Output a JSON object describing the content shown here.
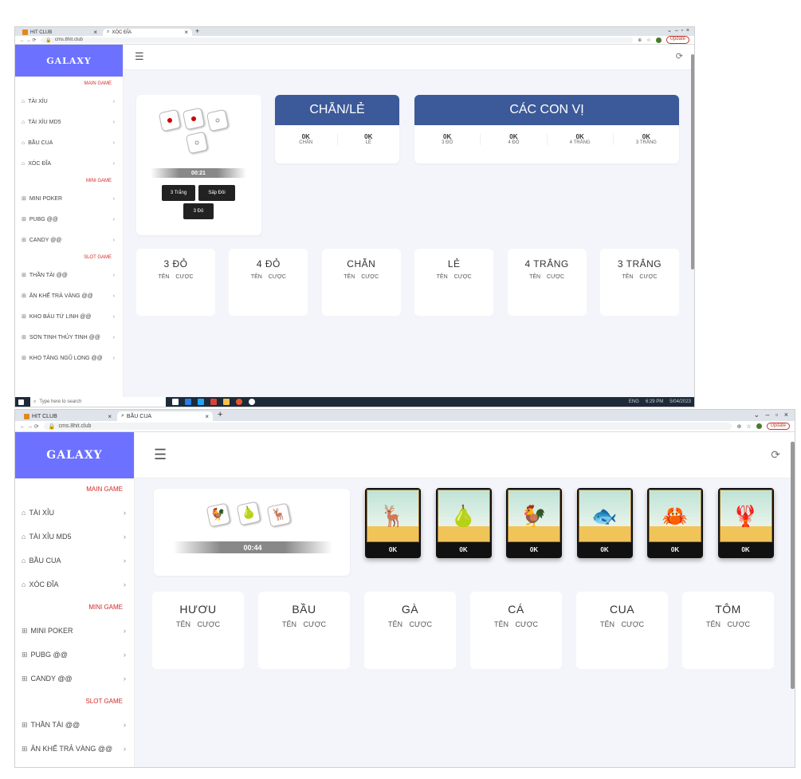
{
  "top": {
    "tabs": [
      {
        "label": "HIT CLUB"
      },
      {
        "label": "XÓC ĐĨA"
      }
    ],
    "new_tab": "+",
    "url": "cms.8hit.club",
    "update_label": "Update",
    "logo": "GALAXY",
    "sections": {
      "main": "MAIN GAME",
      "mini": "MINI GAME",
      "slot": "SLOT GAME"
    },
    "main_items": [
      "TÀI XỈU",
      "TÀI XỈU MD5",
      "BẦU CUA",
      "XÓC ĐĨA"
    ],
    "mini_items": [
      "MINI POKER",
      "PUBG @@",
      "CANDY @@"
    ],
    "slot_items": [
      "THẦN TÀI @@",
      "ĂN KHẾ TRẢ VÀNG @@",
      "KHO BÁU TỨ LINH @@",
      "SƠN TINH THỦY TINH @@",
      "KHO TÀNG NGŨ LONG @@"
    ],
    "timer": "00:21",
    "result_buttons": [
      "3 Trắng",
      "Sấp Đôi",
      "3 Đỏ"
    ],
    "chan_le": {
      "title": "CHẴN/LẺ",
      "cells": [
        {
          "value": "0K",
          "label": "CHẴN"
        },
        {
          "value": "0K",
          "label": "LẺ"
        }
      ]
    },
    "con_vi": {
      "title": "CÁC CON VỊ",
      "cells": [
        {
          "value": "0K",
          "label": "3 ĐỎ"
        },
        {
          "value": "0K",
          "label": "4 ĐỎ"
        },
        {
          "value": "0K",
          "label": "4 TRẮNG"
        },
        {
          "value": "0K",
          "label": "3 TRẮNG"
        }
      ]
    },
    "bets": [
      "3 ĐỎ",
      "4 ĐỎ",
      "CHẴN",
      "LẺ",
      "4 TRẮNG",
      "3 TRẮNG"
    ],
    "bet_sub": "TÊN CƯỢC",
    "taskbar": {
      "search": "Type here to search",
      "lang": "ENG",
      "time": "6:29 PM",
      "date": "5/04/2023"
    }
  },
  "bottom": {
    "tabs": [
      {
        "label": "HIT CLUB"
      },
      {
        "label": "BẦU CUA"
      }
    ],
    "new_tab": "+",
    "url": "cms.8hit.club",
    "update_label": "Update",
    "logo": "GALAXY",
    "sections": {
      "main": "MAIN GAME",
      "mini": "MINI GAME",
      "slot": "SLOT GAME"
    },
    "main_items": [
      "TÀI XỈU",
      "TÀI XỈU MD5",
      "BẦU CUA",
      "XÓC ĐĨA"
    ],
    "mini_items": [
      "MINI POKER",
      "PUBG @@",
      "CANDY @@"
    ],
    "slot_items": [
      "THẦN TÀI @@",
      "ĂN KHẾ TRẢ VÀNG @@"
    ],
    "timer": "00:44",
    "animals": [
      {
        "glyph": "🦌",
        "value": "0K"
      },
      {
        "glyph": "🍐",
        "value": "0K"
      },
      {
        "glyph": "🐓",
        "value": "0K"
      },
      {
        "glyph": "🐟",
        "value": "0K"
      },
      {
        "glyph": "🦀",
        "value": "0K"
      },
      {
        "glyph": "🦞",
        "value": "0K"
      }
    ],
    "bets": [
      "HƯƠU",
      "BẦU",
      "GÀ",
      "CÁ",
      "CUA",
      "TÔM"
    ],
    "bet_sub": "TÊN CƯỢC"
  },
  "colors": {
    "accent": "#6c72ff",
    "header": "#3c5a99",
    "section": "#d62828",
    "dice_red": "#d10000"
  }
}
